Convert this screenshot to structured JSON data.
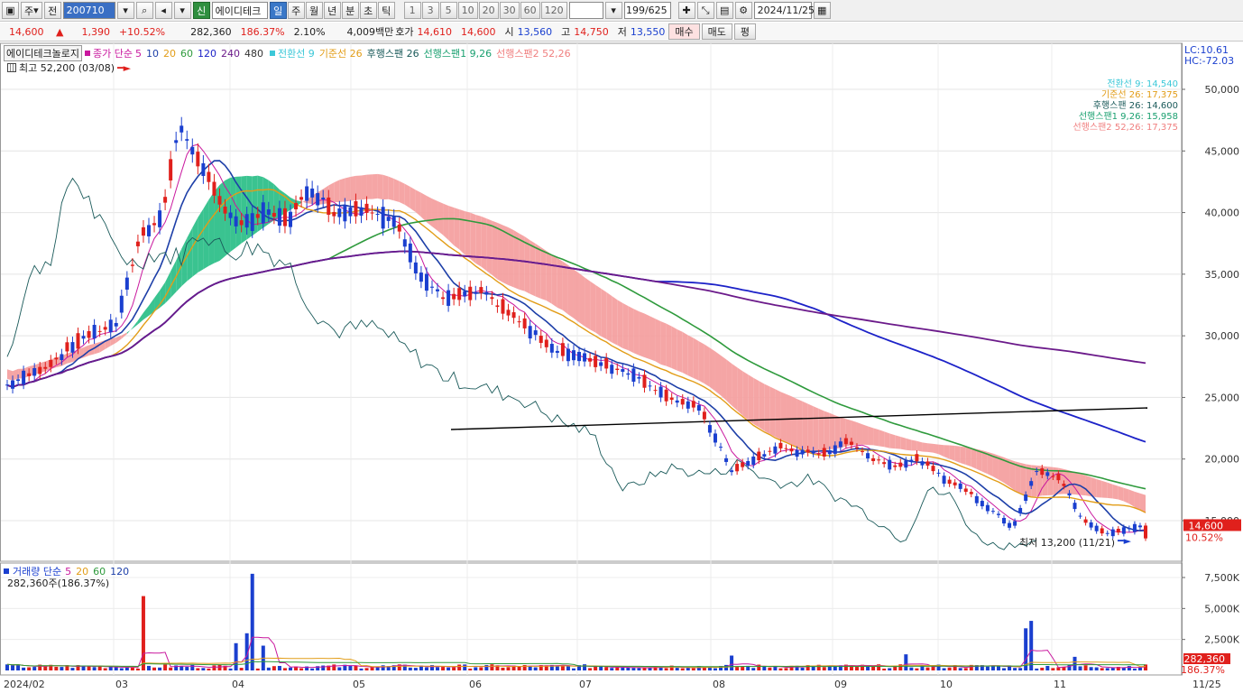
{
  "toolbar": {
    "period_mode": "주",
    "prev_label": "전",
    "code": "200710",
    "stock_badge": "신",
    "stock_name": "에이디테크",
    "tabs": [
      "일",
      "주",
      "월",
      "년",
      "분",
      "초",
      "틱"
    ],
    "active_tab": "일",
    "minute_options": [
      "1",
      "3",
      "5",
      "10",
      "20",
      "30",
      "60",
      "120"
    ],
    "count": "199/625",
    "date": "2024/11/25"
  },
  "quote": {
    "price": "14,600",
    "change_arrow": "▲",
    "change": "1,390",
    "change_pct": "+10.52%",
    "volume": "282,360",
    "volume_ratio": "186.37%",
    "turnover": "2.10%",
    "amount": "4,009백만",
    "ask_label": "호가",
    "ask": "14,610",
    "bid": "14,600",
    "open_label": "시",
    "open": "13,560",
    "high_label": "고",
    "high": "14,750",
    "low_label": "저",
    "low": "13,550",
    "buy_label": "매수",
    "sell_label": "매도",
    "eval_label": "평"
  },
  "price_panel": {
    "name_tag": "에이디테크놀로지",
    "legend_close": "종가 단순",
    "ma_periods": [
      "5",
      "10",
      "20",
      "60",
      "120",
      "240",
      "480"
    ],
    "ma_colors": [
      "#c9189e",
      "#1d3fa8",
      "#e29d18",
      "#2e9a3c",
      "#1c22c8",
      "#6b1a8a",
      "#333333"
    ],
    "ichimoku_legend": [
      "전환선 9",
      "기준선 26",
      "후행스팬 26",
      "선행스팬1 9,26",
      "선행스팬2 52,26"
    ],
    "ichimoku_colors": [
      "#3cc8d8",
      "#e29d18",
      "#1a5a5a",
      "#1aa070",
      "#f08080"
    ],
    "high_marker": "최고 52,200 (03/08)",
    "low_marker": "최저 13,200 (11/21)",
    "lc": "LC:10.61",
    "hc": "HC:-72.03",
    "ichimoku_values": [
      "전환선 9: 14,540",
      "기준선 26: 17,375",
      "후행스팬 26: 14,600",
      "선행스팬1 9,26: 15,958",
      "선행스팬2 52,26: 17,375"
    ],
    "y_ticks": [
      "50,000",
      "45,000",
      "40,000",
      "35,000",
      "30,000",
      "25,000",
      "20,000",
      "15,000"
    ],
    "current_price": "14,600",
    "current_pct": "10.52%"
  },
  "volume_panel": {
    "legend_label": "거래량 단순",
    "ma_periods": [
      "5",
      "20",
      "60",
      "120"
    ],
    "ma_colors": [
      "#c9189e",
      "#e29d18",
      "#2e9a3c",
      "#1d3fa8"
    ],
    "sub_label": "282,360주(186.37%)",
    "y_ticks": [
      "7,500K",
      "5,000K",
      "2,500K"
    ],
    "current_volume": "282,360",
    "current_pct": "186.37%"
  },
  "x_axis": {
    "labels": [
      "2024/02",
      "03",
      "04",
      "05",
      "06",
      "07",
      "08",
      "09",
      "10",
      "11",
      "11/25"
    ]
  }
}
